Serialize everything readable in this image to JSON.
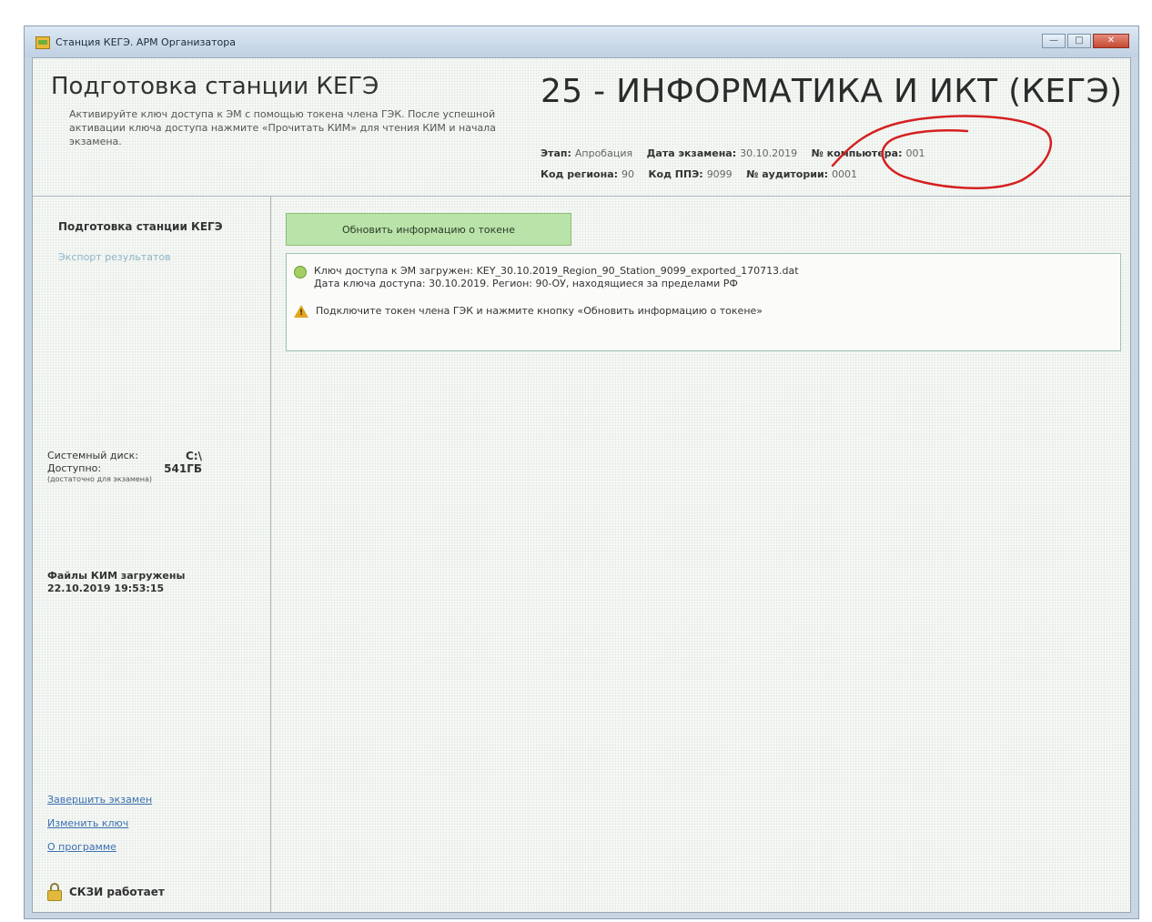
{
  "window": {
    "title": "Станция КЕГЭ. АРМ Организатора",
    "controls": {
      "minimize": "—",
      "maximize": "□",
      "close": "✕"
    }
  },
  "header": {
    "title": "Подготовка станции КЕГЭ",
    "description": "Активируйте ключ доступа к ЭМ с помощью токена члена ГЭК. После успешной активации ключа доступа нажмите «Прочитать КИМ» для чтения КИМ и начала экзамена.",
    "exam_title": "25 - ИНФОРМАТИКА И ИКТ (КЕГЭ)",
    "meta": {
      "stage_label": "Этап:",
      "stage_value": "Апробация",
      "date_label": "Дата экзамена:",
      "date_value": "30.10.2019",
      "computer_label": "№ компьютера:",
      "computer_value": "001",
      "region_label": "Код региона:",
      "region_value": "90",
      "ppe_label": "Код ППЭ:",
      "ppe_value": "9099",
      "room_label": "№ аудитории:",
      "room_value": "0001"
    }
  },
  "sidebar": {
    "title": "Подготовка станции КЕГЭ",
    "export_link": "Экспорт результатов",
    "disk": {
      "system_label": "Системный диск:",
      "system_value": "C:\\",
      "available_label": "Доступно:",
      "available_value": "541ГБ",
      "note": "(достаточно для экзамена)"
    },
    "kim_files": "Файлы КИМ загружены",
    "kim_date": "22.10.2019 19:53:15",
    "links": [
      "Завершить экзамен",
      "Изменить ключ",
      "О программе"
    ],
    "skzi_status": "СКЗИ работает"
  },
  "main": {
    "refresh_button": "Обновить информацию о токене",
    "messages": {
      "key_loaded": "Ключ доступа к ЭМ загружен: KEY_30.10.2019_Region_90_Station_9099_exported_170713.dat",
      "key_date": "Дата ключа доступа: 30.10.2019. Регион: 90-ОУ, находящиеся за пределами РФ",
      "warning": "Подключите токен члена ГЭК и нажмите кнопку «Обновить информацию о токене»"
    }
  },
  "colors": {
    "accent_button": "#b9e3a8",
    "annotation": "#d42020",
    "link": "#3d6fb0"
  }
}
